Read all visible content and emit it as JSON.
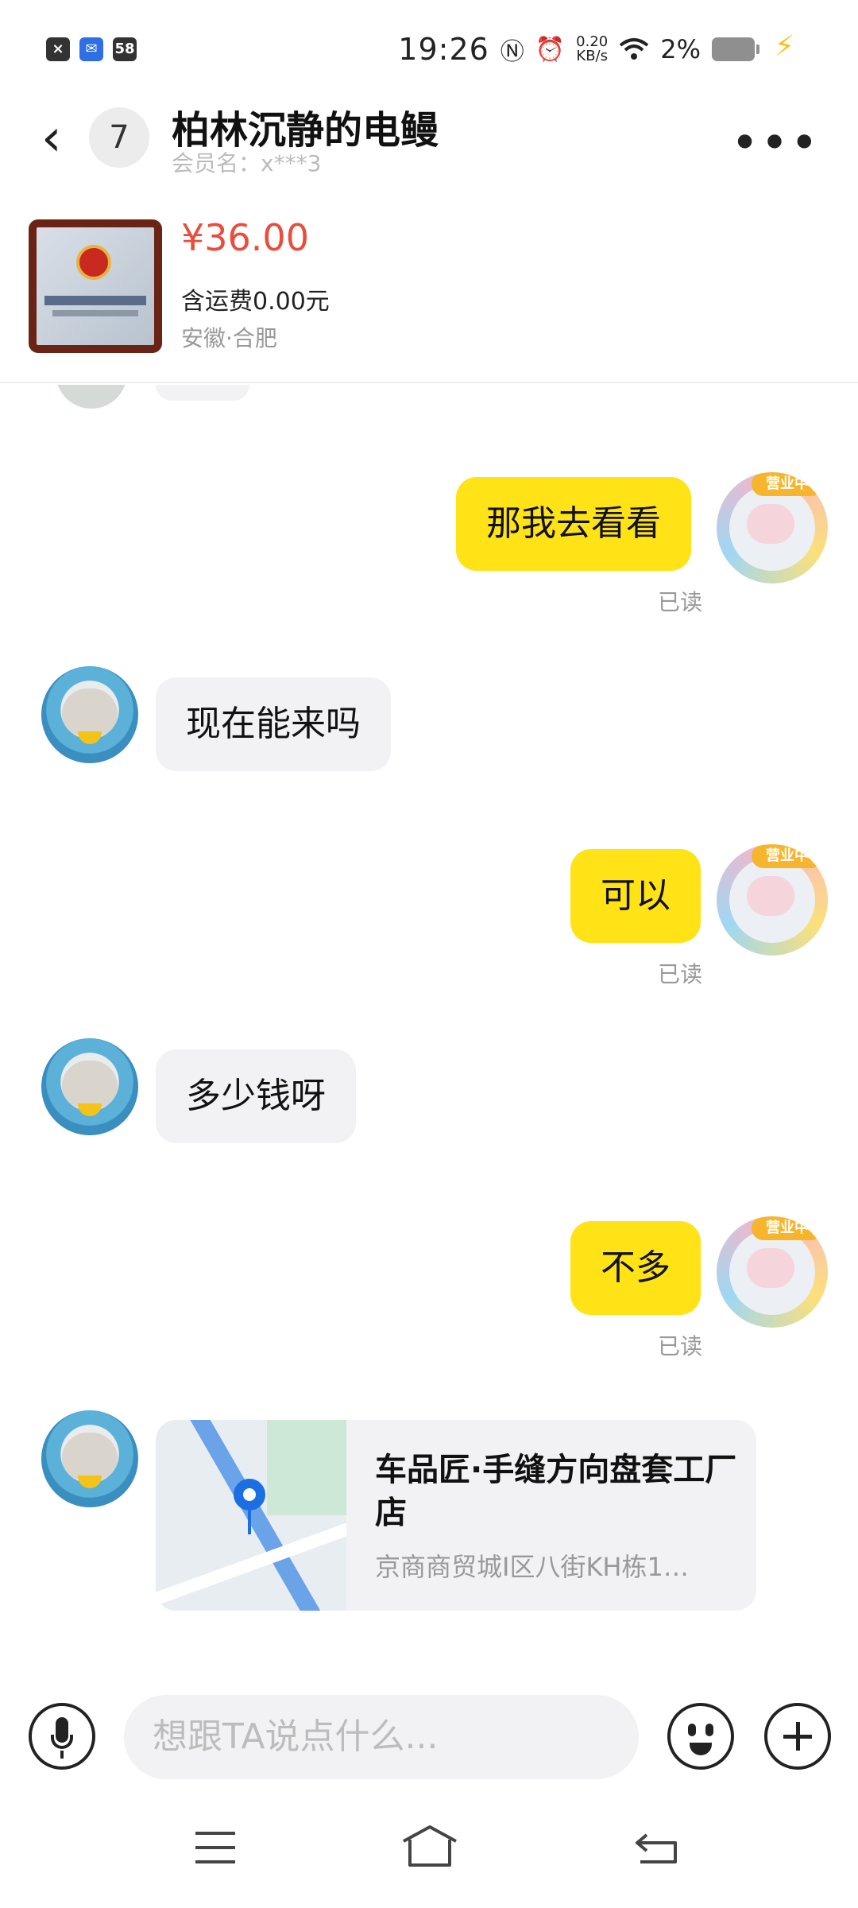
{
  "status_bar": {
    "notif_icons": [
      "×",
      "✉",
      "58"
    ],
    "time": "19:26",
    "net_speed_value": "0.20",
    "net_speed_unit": "KB/s",
    "battery": "2%"
  },
  "header": {
    "back_glyph": "‹",
    "unread_count": "7",
    "contact_name": "柏林沉静的电鳗",
    "member_label": "会员名：x***3",
    "more_glyph": "•••"
  },
  "product": {
    "price": "¥36.00",
    "shipping": "含运费0.00元",
    "location": "安徽·合肥"
  },
  "messages": [
    {
      "from": "me",
      "text": "那我去看看",
      "read": "已读"
    },
    {
      "from": "them",
      "text": "现在能来吗"
    },
    {
      "from": "me",
      "text": "可以",
      "read": "已读"
    },
    {
      "from": "them",
      "text": "多少钱呀"
    },
    {
      "from": "me",
      "text": "不多",
      "read": "已读"
    }
  ],
  "location_message": {
    "title": "车品匠·手缝方向盘套工厂店",
    "address": "京商商贸城I区八街KH栋1…"
  },
  "input": {
    "placeholder": "想跟TA说点什么..."
  },
  "avatar_badge": "营业中",
  "colors": {
    "accent_yellow": "#ffe317",
    "price_red": "#e84d3d",
    "bubble_gray": "#f2f2f4"
  }
}
